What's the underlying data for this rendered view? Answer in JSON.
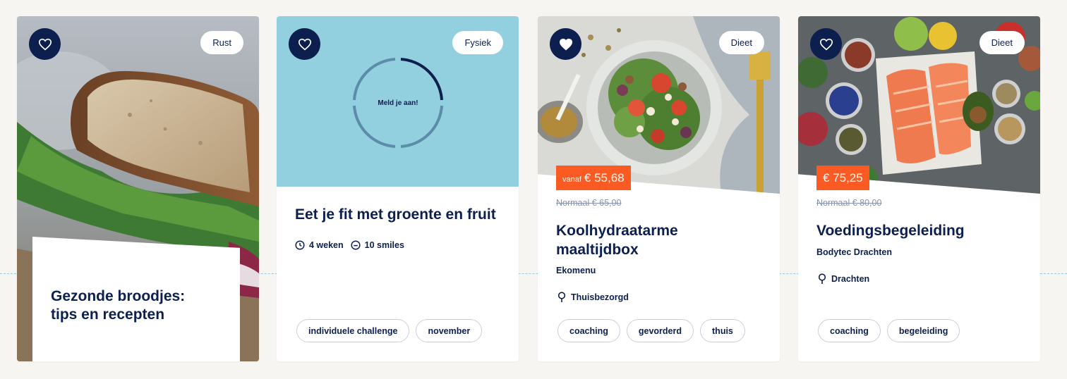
{
  "colors": {
    "navy": "#0c1f4f",
    "accent_orange": "#fb5a22",
    "challenge_blue": "#92d0e0",
    "background": "#f6f5f1"
  },
  "cards": [
    {
      "category": "Rust",
      "title": "Gezonde broodjes: tips en recepten",
      "favorite_icon": "heart-outline-icon",
      "favorited": false
    },
    {
      "category": "Fysiek",
      "ring_label": "Meld je aan!",
      "title": "Eet je fit met groente en fruit",
      "duration": "4 weken",
      "smiles": "10 smiles",
      "tags": [
        "individuele challenge",
        "november"
      ],
      "favorite_icon": "heart-outline-icon",
      "favorited": false
    },
    {
      "category": "Dieet",
      "price_prefix": "vanaf",
      "price": "€ 55,68",
      "old_price": "Normaal € 65,00",
      "title": "Koolhydraatarme maaltijdbox",
      "vendor": "Ekomenu",
      "location": "Thuisbezorgd",
      "tags": [
        "coaching",
        "gevorderd",
        "thuis"
      ],
      "favorite_icon": "heart-filled-icon",
      "favorited": true
    },
    {
      "category": "Dieet",
      "price": "€ 75,25",
      "old_price": "Normaal € 80,00",
      "title": "Voedingsbegeleiding",
      "vendor": "Bodytec Drachten",
      "location": "Drachten",
      "tags": [
        "coaching",
        "begeleiding"
      ],
      "favorite_icon": "heart-outline-icon",
      "favorited": false
    }
  ]
}
